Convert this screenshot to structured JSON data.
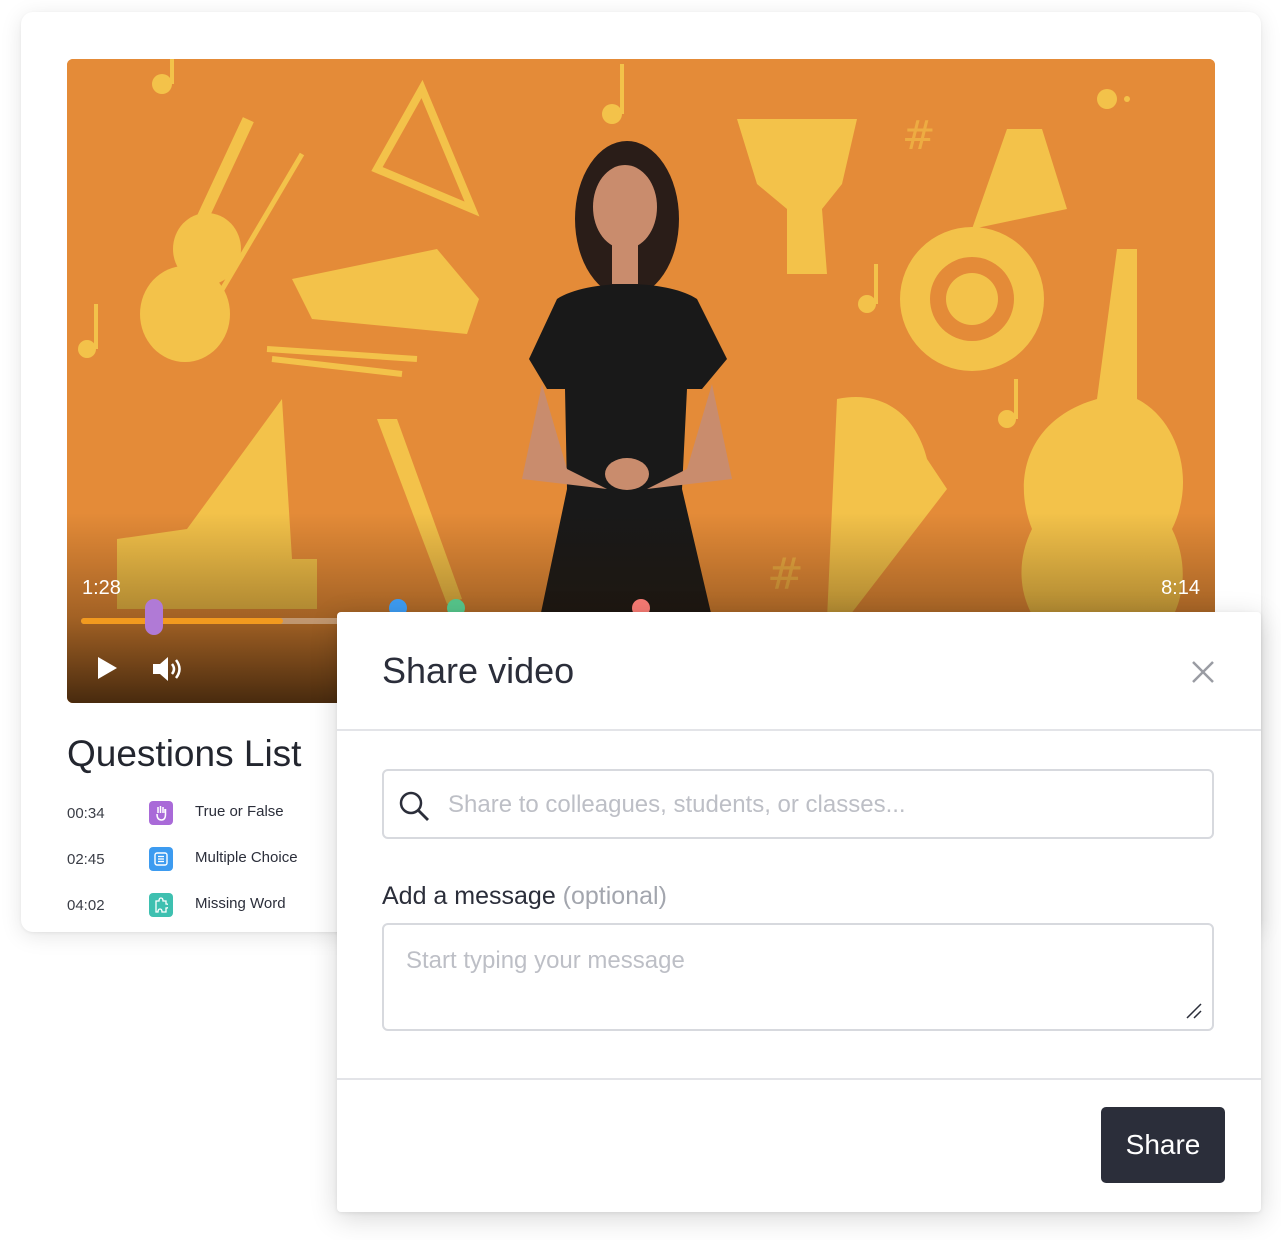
{
  "player": {
    "current_time": "1:28",
    "duration": "8:14",
    "progress_fraction": 0.18,
    "played_color": "#f29a1f",
    "markers": [
      {
        "color": "#3d9bf0",
        "fraction": 0.283
      },
      {
        "color": "#55c48a",
        "fraction": 0.335
      },
      {
        "color": "#f57a73",
        "fraction": 0.5
      }
    ],
    "handle_color": "#b07ad6",
    "controls": {
      "play_icon": "play-icon",
      "volume_icon": "volume-icon"
    }
  },
  "questions": {
    "title": "Questions List",
    "items": [
      {
        "time": "00:34",
        "label": "True or False",
        "icon": "hand-icon",
        "color": "#a96ad8"
      },
      {
        "time": "02:45",
        "label": "Multiple Choice",
        "icon": "list-icon",
        "color": "#3d9bf0"
      },
      {
        "time": "04:02",
        "label": "Missing Word",
        "icon": "puzzle-icon",
        "color": "#3ec0b0"
      }
    ]
  },
  "share_dialog": {
    "title": "Share video",
    "search_placeholder": "Share to colleagues, students, or classes...",
    "message_label": "Add a message",
    "message_optional": "(optional)",
    "message_placeholder": "Start typing your message",
    "share_button": "Share"
  }
}
